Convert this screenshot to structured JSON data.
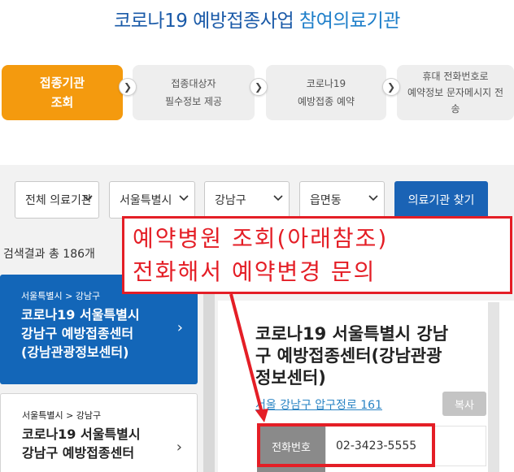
{
  "page": {
    "title_main": "코로나19 예방접종사업",
    "title_accent": "참여의료기관"
  },
  "steps": [
    {
      "line1": "접종기관",
      "line2": "조회"
    },
    {
      "line1": "접종대상자",
      "line2": "필수정보 제공"
    },
    {
      "line1": "코로나19",
      "line2": "예방접종 예약"
    },
    {
      "line1": "휴대 전화번호로",
      "line2": "예약정보 문자메시지 전",
      "line3": "송"
    }
  ],
  "filters": {
    "type": "전체 의료기관",
    "city": "서울특별시",
    "district": "강남구",
    "town": "읍면동",
    "search_label": "의료기관 찾기"
  },
  "results": {
    "count_text": "검색결과 총 186개",
    "cards": [
      {
        "crumb": "서울특별시 > 강남구",
        "name_line1": "코로나19 서울특별시",
        "name_line2": "강남구 예방접종센터",
        "name_line3": "(강남관광정보센터)"
      },
      {
        "crumb": "서울특별시 > 강남구",
        "name_line1": "코로나19 서울특별시",
        "name_line2": "강남구 예방접종센터"
      }
    ]
  },
  "detail": {
    "name_line1": "코로나19 서울특별시 강남",
    "name_line2": "구 예방접종센터(강남관광",
    "name_line3": "정보센터)",
    "address": "서울 강남구 압구정로 161",
    "copy_label": "복사",
    "phone_label": "전화번호",
    "phone_value": "02-3423-5555"
  },
  "annotation": {
    "line1": "예약병원 조회(아래참조)",
    "line2": "전화해서 예약변경 문의"
  },
  "colors": {
    "brand_blue": "#1a63b5",
    "step_active": "#f49a0e",
    "annotation_red": "#e41e26"
  }
}
